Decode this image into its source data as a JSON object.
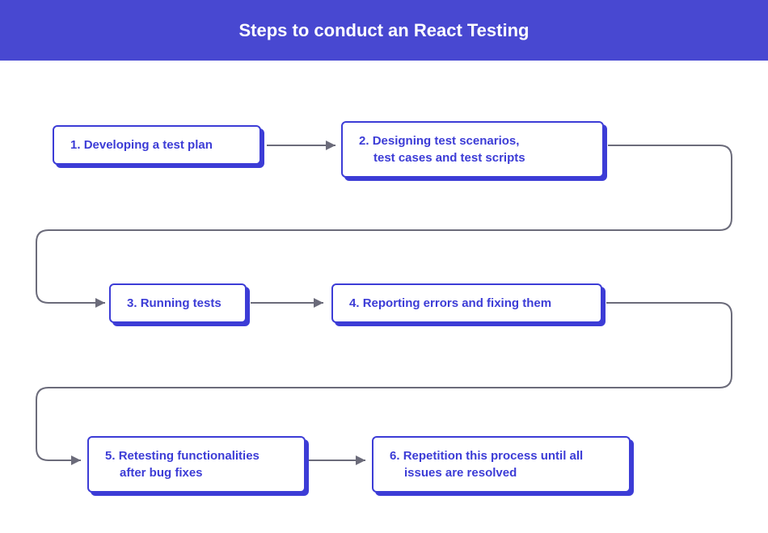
{
  "header": {
    "title": "Steps to conduct an React Testing"
  },
  "colors": {
    "brand": "#4848d1",
    "boxBorder": "#3c3cd6",
    "connector": "#6b6b7a"
  },
  "steps": [
    {
      "num": "1.",
      "text": "Developing a test plan",
      "multiline": false
    },
    {
      "num": "2.",
      "text": "Designing test scenarios,",
      "text2": "test cases and test scripts",
      "multiline": true
    },
    {
      "num": "3.",
      "text": "Running tests",
      "multiline": false
    },
    {
      "num": "4.",
      "text": "Reporting errors and fixing them",
      "multiline": false
    },
    {
      "num": "5.",
      "text": "Retesting functionalities",
      "text2": "after bug fixes",
      "multiline": true
    },
    {
      "num": "6.",
      "text": "Repetition this process until all",
      "text2": "issues are resolved",
      "multiline": true
    }
  ]
}
